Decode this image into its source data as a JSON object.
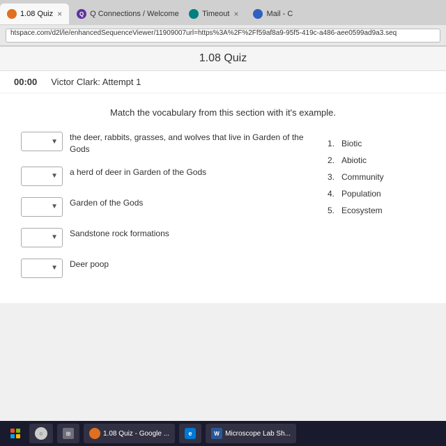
{
  "browser": {
    "tabs": [
      {
        "id": "tab1",
        "label": "1.08 Quiz",
        "icon_type": "orange",
        "active": true
      },
      {
        "id": "tab2",
        "label": "Q Connections / Welcome",
        "icon_type": "purple",
        "active": false
      },
      {
        "id": "tab3",
        "label": "Timeout",
        "icon_type": "teal",
        "active": false
      },
      {
        "id": "tab4",
        "label": "Mail - C",
        "icon_type": "blue",
        "active": false
      }
    ],
    "address": "htspace.com/d2l/le/enhancedSequenceViewer/11909007url=https%3A%2F%2Ff59af8a9-95f5-419c-a486-aee0599ad9a3.seq"
  },
  "page": {
    "title": "1.08 Quiz",
    "timer": "00:00",
    "attempt_info": "Victor Clark: Attempt 1",
    "question": "Match the vocabulary from this section with it's example."
  },
  "matching": {
    "left_items": [
      {
        "description": "the deer, rabbits, grasses, and wolves that live in Garden of the Gods"
      },
      {
        "description": "a herd of deer in Garden of the Gods"
      },
      {
        "description": "Garden of the Gods"
      },
      {
        "description": "Sandstone rock formations"
      },
      {
        "description": "Deer poop"
      }
    ],
    "right_items": [
      {
        "number": "1.",
        "label": "Biotic"
      },
      {
        "number": "2.",
        "label": "Abiotic"
      },
      {
        "number": "3.",
        "label": "Community"
      },
      {
        "number": "4.",
        "label": "Population"
      },
      {
        "number": "5.",
        "label": "Ecosystem"
      }
    ]
  },
  "taskbar": {
    "items": [
      {
        "label": "1.08 Quiz - Google ...",
        "type": "quiz"
      },
      {
        "label": "Microscope Lab Sh...",
        "type": "word"
      }
    ]
  }
}
